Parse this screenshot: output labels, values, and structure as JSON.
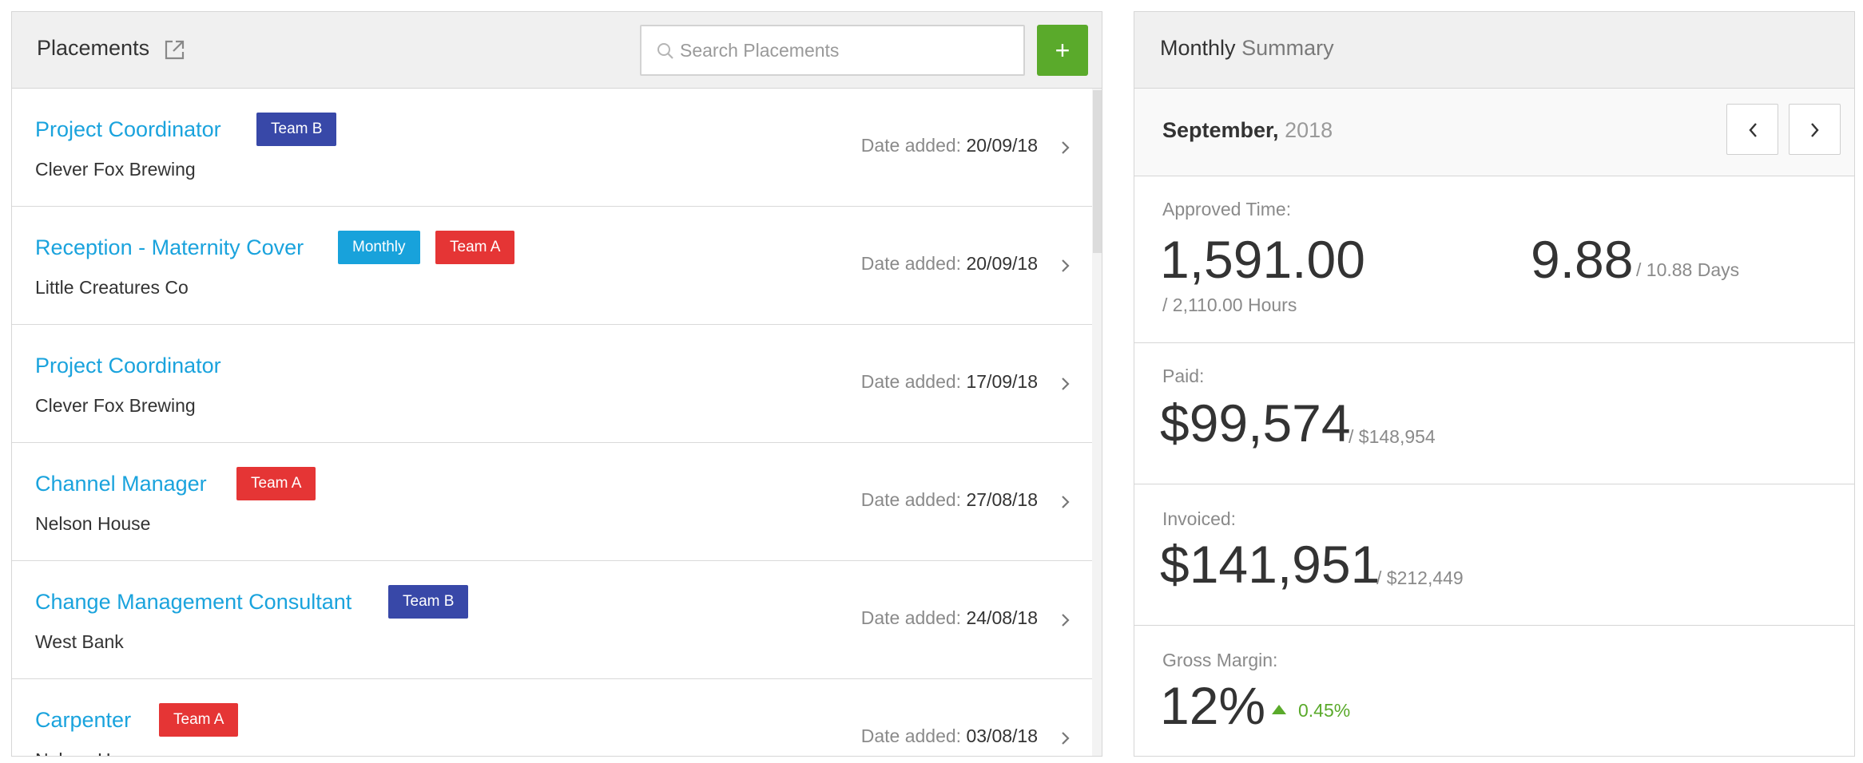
{
  "placements": {
    "title": "Placements",
    "search_placeholder": "Search Placements",
    "add_label": "+",
    "date_prefix": "Date added:",
    "rows": [
      {
        "title": "Project Coordinator",
        "company": "Clever Fox Brewing",
        "date": "20/09/18",
        "badges": [
          "Team B"
        ]
      },
      {
        "title": "Reception - Maternity Cover",
        "company": "Little Creatures Co",
        "date": "20/09/18",
        "badges": [
          "Monthly",
          "Team A"
        ]
      },
      {
        "title": "Project Coordinator",
        "company": "Clever Fox Brewing",
        "date": "17/09/18",
        "badges": []
      },
      {
        "title": "Channel Manager",
        "company": "Nelson House",
        "date": "27/08/18",
        "badges": [
          "Team A"
        ]
      },
      {
        "title": "Change Management Consultant",
        "company": "West Bank",
        "date": "24/08/18",
        "badges": [
          "Team B"
        ]
      },
      {
        "title": "Carpenter",
        "company": "Nelson House",
        "date": "03/08/18",
        "badges": [
          "Team A"
        ]
      }
    ]
  },
  "summary": {
    "title_main": "Monthly",
    "title_light": "Summary",
    "month": "September,",
    "year": "2018",
    "approved": {
      "label": "Approved Time:",
      "hours": "1,591.00",
      "hours_total": "/ 2,110.00 Hours",
      "days": "9.88",
      "days_total": "/ 10.88 Days"
    },
    "paid": {
      "label": "Paid:",
      "value": "$99,574",
      "total": "/ $148,954"
    },
    "invoiced": {
      "label": "Invoiced:",
      "value": "$141,951",
      "total": "/ $212,449"
    },
    "gross_margin": {
      "label": "Gross Margin:",
      "value": "12%",
      "change": "0.45%"
    }
  },
  "colors": {
    "link": "#1aa3dd",
    "team_a": "#e53535",
    "team_b": "#3848a8",
    "monthly": "#18a2db",
    "accent_green": "#5aaa2b"
  },
  "icons": {
    "open_external": "external-link-icon",
    "search": "search-icon",
    "row_chevron": "chevron-right-icon",
    "prev": "chevron-left-icon",
    "next": "chevron-right-icon",
    "trend_up": "triangle-up-icon"
  }
}
